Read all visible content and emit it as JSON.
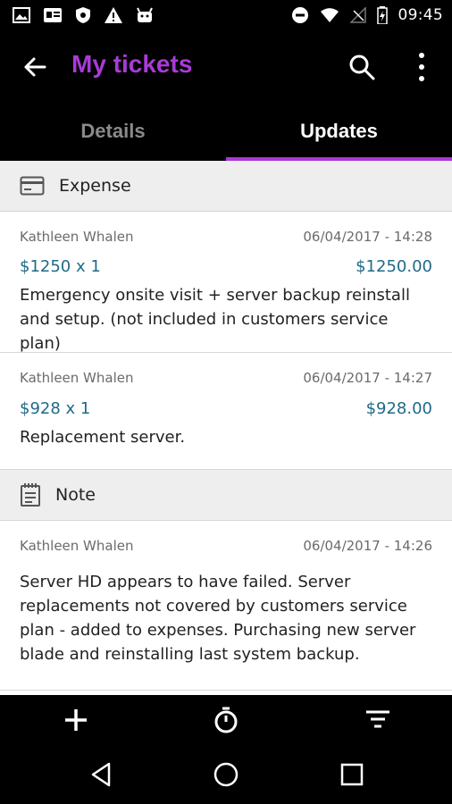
{
  "status_bar": {
    "time": "09:45",
    "left_icons": [
      "image-icon",
      "card-icon",
      "shield-icon",
      "warning-icon",
      "android-icon"
    ],
    "right_icons": [
      "do-not-disturb-icon",
      "wifi-icon",
      "no-signal-icon",
      "battery-charging-icon"
    ]
  },
  "app_bar": {
    "title": "My tickets",
    "title_color": "#a93bd6"
  },
  "tabs": [
    {
      "label": "Details",
      "active": false
    },
    {
      "label": "Updates",
      "active": true
    }
  ],
  "sections": {
    "expense": {
      "label": "Expense",
      "entries": [
        {
          "author": "Kathleen Whalen",
          "timestamp": "06/04/2017 - 14:28",
          "quantity_text": "$1250 x 1",
          "total": "$1250.00",
          "description": "Emergency onsite visit + server backup reinstall and setup. (not included in customers service plan)"
        },
        {
          "author": "Kathleen Whalen",
          "timestamp": "06/04/2017 - 14:27",
          "quantity_text": "$928 x 1",
          "total": "$928.00",
          "description": "Replacement server."
        }
      ]
    },
    "note": {
      "label": "Note",
      "entries": [
        {
          "author": "Kathleen Whalen",
          "timestamp": "06/04/2017 - 14:26",
          "description": "Server HD appears to have failed. Server replacements not covered by customers service plan - added to expenses. Purchasing new server blade and reinstalling last system backup."
        }
      ]
    }
  },
  "bottom_actions": [
    "add-icon",
    "timer-icon",
    "filter-icon"
  ],
  "nav_buttons": [
    "back-triangle-icon",
    "home-circle-icon",
    "recents-square-icon"
  ],
  "colors": {
    "accent": "#a93bd6",
    "amount_text": "#1f6a88",
    "section_bg": "#eeeeee"
  }
}
